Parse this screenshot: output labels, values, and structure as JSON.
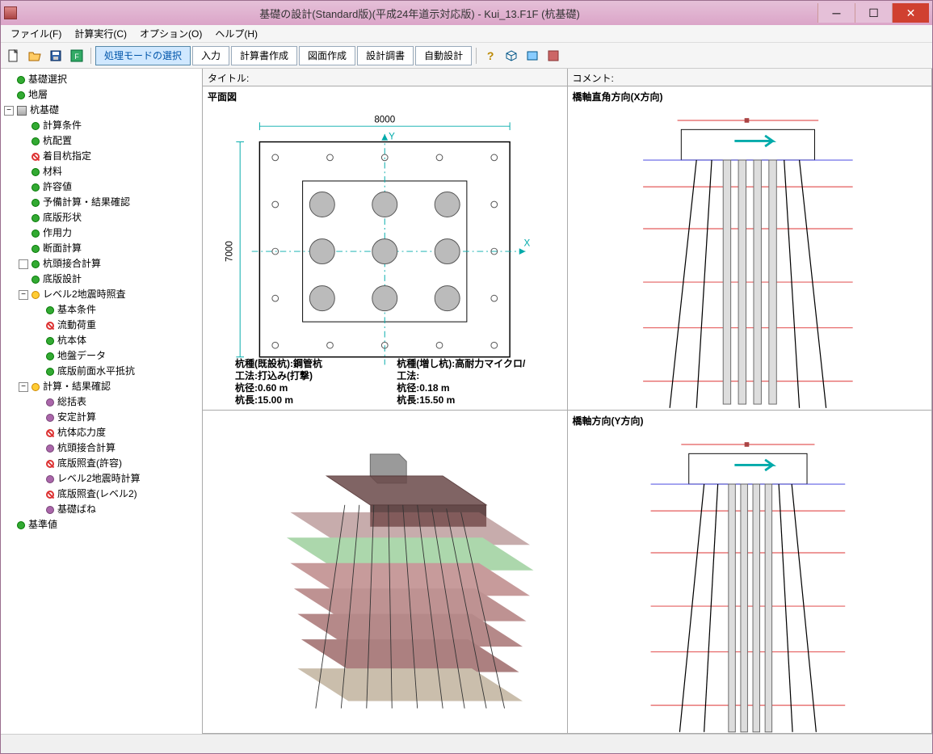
{
  "window": {
    "title": "基礎の設計(Standard版)(平成24年道示対応版) - Kui_13.F1F (杭基礎)"
  },
  "menu": {
    "file": "ファイル(F)",
    "calc": "計算実行(C)",
    "option": "オプション(O)",
    "help": "ヘルプ(H)"
  },
  "toolbar": {
    "mode_select": "処理モードの選択",
    "input": "入力",
    "report": "計算書作成",
    "drawing": "図面作成",
    "design_report": "設計調書",
    "auto_design": "自動設計"
  },
  "tree": {
    "n0": "基礎選択",
    "n1": "地層",
    "n2": "杭基礎",
    "n2_0": "計算条件",
    "n2_1": "杭配置",
    "n2_2": "着目杭指定",
    "n2_3": "材料",
    "n2_4": "許容値",
    "n2_5": "予備計算・結果確認",
    "n2_6": "底版形状",
    "n2_7": "作用力",
    "n2_8": "断面計算",
    "n2_9": "杭頭接合計算",
    "n2_10": "底版設計",
    "n2_11": "レベル2地震時照査",
    "n2_11_0": "基本条件",
    "n2_11_1": "流動荷重",
    "n2_11_2": "杭本体",
    "n2_11_3": "地盤データ",
    "n2_11_4": "底版前面水平抵抗",
    "n2_12": "計算・結果確認",
    "n2_12_0": "総括表",
    "n2_12_1": "安定計算",
    "n2_12_2": "杭体応力度",
    "n2_12_3": "杭頭接合計算",
    "n2_12_4": "底版照査(許容)",
    "n2_12_5": "レベル2地震時計算",
    "n2_12_6": "底版照査(レベル2)",
    "n2_12_7": "基礎ばね",
    "n3": "基準値"
  },
  "views": {
    "title_label": "タイトル:",
    "comment_label": "コメント:",
    "plan_title": "平面図",
    "side_x_title": "橋軸直角方向(X方向)",
    "side_y_title": "橋軸方向(Y方向)"
  },
  "plan": {
    "dim_w": "8000",
    "dim_h": "7000",
    "axis_x": "X",
    "axis_y": "Y",
    "info_left": {
      "type": "杭種(既設杭):鋼管杭",
      "method": "工法:打込み(打撃)",
      "dia": "杭径:0.60 m",
      "len": "杭長:15.00 m"
    },
    "info_right": {
      "type": "杭種(増し杭):高耐力マイクロ/",
      "method": "工法:",
      "dia": "杭径:0.18 m",
      "len": "杭長:15.50 m"
    }
  }
}
